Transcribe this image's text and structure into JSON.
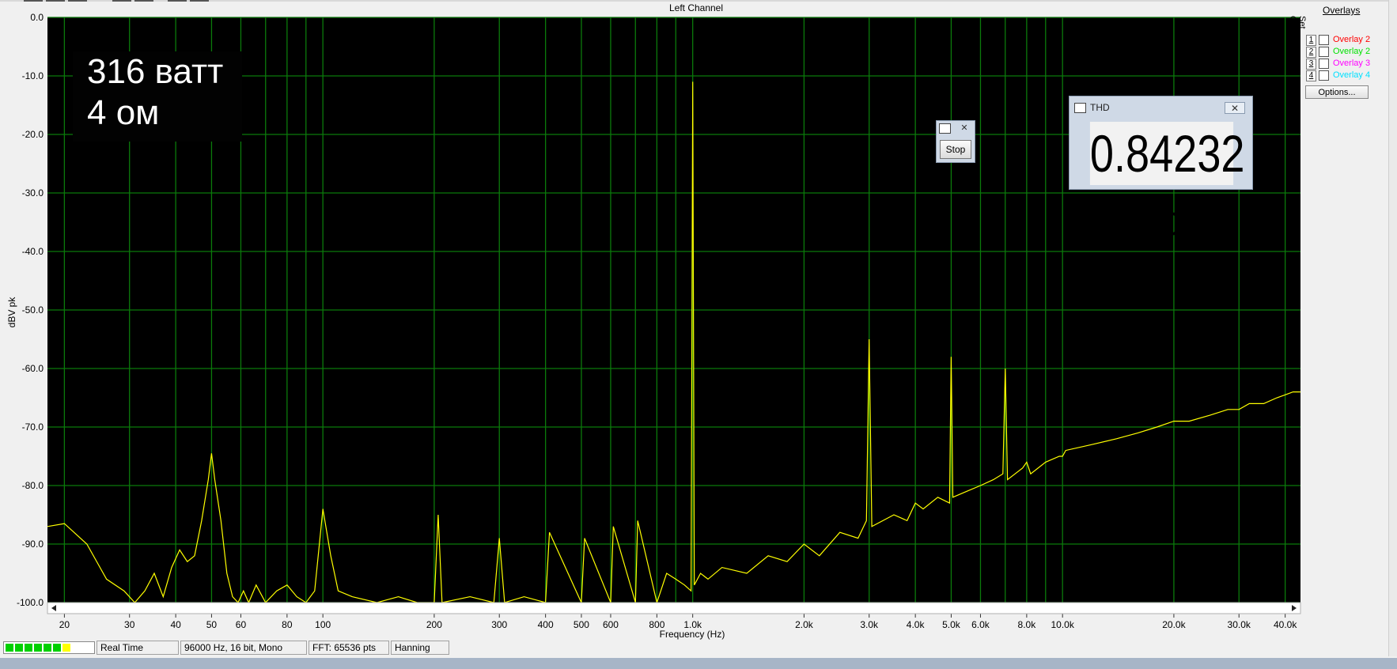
{
  "window": {
    "chart_title": "Left Channel",
    "annotation_lines": [
      "316 ватт",
      "4 ом"
    ]
  },
  "chart_data": {
    "type": "line",
    "title": "Left Channel",
    "xlabel": "Frequency (Hz)",
    "ylabel": "dBV pk",
    "xscale": "log",
    "xlim": [
      18,
      44000
    ],
    "ylim": [
      -100,
      0
    ],
    "x_ticks": [
      20,
      30,
      40,
      50,
      60,
      80,
      100,
      200,
      300,
      400,
      500,
      600,
      800,
      1000,
      2000,
      3000,
      4000,
      5000,
      6000,
      8000,
      10000,
      20000,
      30000,
      40000
    ],
    "x_tick_labels": [
      "20",
      "30",
      "40",
      "50",
      "60",
      "80",
      "100",
      "200",
      "300",
      "400",
      "500",
      "600",
      "800",
      "1.0k",
      "2.0k",
      "3.0k",
      "4.0k",
      "5.0k",
      "6.0k",
      "8.0k",
      "10.0k",
      "20.0k",
      "30.0k",
      "40.0k"
    ],
    "y_ticks": [
      0,
      -10,
      -20,
      -30,
      -40,
      -50,
      -60,
      -70,
      -80,
      -90,
      -100
    ],
    "y_tick_labels": [
      "0.0",
      "-10.0",
      "-20.0",
      "-30.0",
      "-40.0",
      "-50.0",
      "-60.0",
      "-70.0",
      "-80.0",
      "-90.0",
      "-100.0"
    ],
    "grid": true,
    "background_color": "#000000",
    "grid_color": "#0b7a0b",
    "series": [
      {
        "color": "#ffff00",
        "x": [
          18,
          20,
          23,
          26,
          29,
          31,
          33,
          35,
          37,
          39,
          41,
          43,
          45,
          47,
          49,
          50,
          51,
          53,
          55,
          57,
          59,
          61,
          63,
          66,
          70,
          75,
          80,
          85,
          90,
          95,
          100,
          105,
          110,
          120,
          140,
          160,
          180,
          200,
          205,
          210,
          250,
          290,
          300,
          310,
          350,
          400,
          410,
          500,
          510,
          600,
          610,
          700,
          710,
          800,
          850,
          900,
          950,
          990,
          1000,
          1010,
          1050,
          1100,
          1200,
          1400,
          1600,
          1800,
          2000,
          2200,
          2500,
          2800,
          2950,
          3000,
          3050,
          3500,
          3800,
          4000,
          4200,
          4600,
          4950,
          5000,
          5050,
          5500,
          6000,
          6500,
          6900,
          7000,
          7100,
          7800,
          8000,
          8200,
          9000,
          9800,
          10000,
          10200,
          12000,
          14000,
          16000,
          18000,
          20000,
          22000,
          25000,
          28000,
          30000,
          32000,
          35000,
          38000,
          40000,
          42000,
          44000
        ],
        "y": [
          -87,
          -86.5,
          -90,
          -96,
          -98,
          -100,
          -98,
          -95,
          -99,
          -94,
          -91,
          -93,
          -92,
          -86,
          -79,
          -74.5,
          -79,
          -86,
          -95,
          -99,
          -100,
          -98,
          -100,
          -97,
          -100,
          -98,
          -97,
          -99,
          -100,
          -98,
          -84,
          -92,
          -98,
          -99,
          -100,
          -99,
          -100,
          -100,
          -85,
          -100,
          -99,
          -100,
          -89,
          -100,
          -99,
          -100,
          -88,
          -100,
          -89,
          -100,
          -87,
          -100,
          -86,
          -100,
          -95,
          -96,
          -97,
          -98,
          -11,
          -97,
          -95,
          -96,
          -94,
          -95,
          -92,
          -93,
          -90,
          -92,
          -88,
          -89,
          -86,
          -55,
          -87,
          -85,
          -86,
          -83,
          -84,
          -82,
          -83,
          -58,
          -82,
          -81,
          -80,
          -79,
          -78,
          -60,
          -79,
          -77,
          -76,
          -78,
          -76,
          -75,
          -75,
          -74,
          -73,
          -72,
          -71,
          -70,
          -69,
          -69,
          -68,
          -67,
          -67,
          -66,
          -66,
          -65,
          -64.5,
          -64,
          -64
        ]
      }
    ]
  },
  "overlays": {
    "title": "Overlays",
    "header": "Set On",
    "items": [
      {
        "num": "1",
        "label": "Overlay 2",
        "color": "#ff0000"
      },
      {
        "num": "2",
        "label": "Overlay 2",
        "color": "#00e000"
      },
      {
        "num": "3",
        "label": "Overlay 3",
        "color": "#ff00ff"
      },
      {
        "num": "4",
        "label": "Overlay 4",
        "color": "#00e0ff"
      }
    ],
    "options_label": "Options..."
  },
  "stop_window": {
    "stop_label": "Stop"
  },
  "thd_window": {
    "title": "THD",
    "value": "0.84232 %"
  },
  "status_bar": {
    "mode": "Real Time",
    "format": "96000 Hz, 16 bit, Mono",
    "fft": "FFT: 65536 pts",
    "window": "Hanning"
  }
}
